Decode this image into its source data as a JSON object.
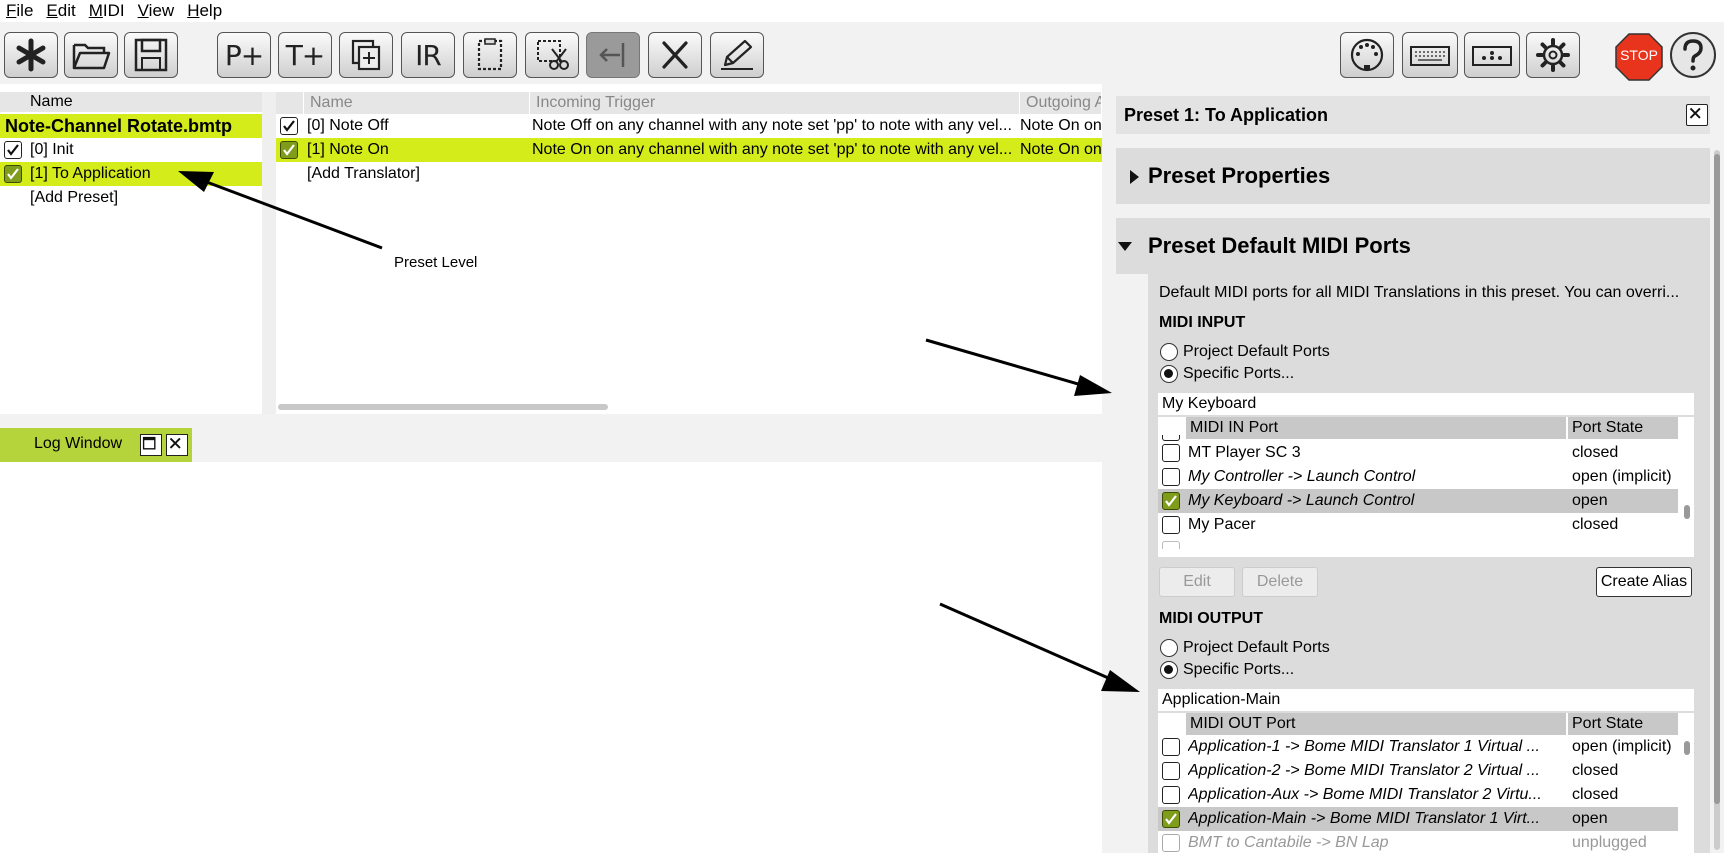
{
  "menu": {
    "items": [
      {
        "key": "F",
        "rest": "ile"
      },
      {
        "key": "E",
        "rest": "dit"
      },
      {
        "key": "M",
        "rest": "IDI"
      },
      {
        "key": "V",
        "rest": "iew"
      },
      {
        "key": "H",
        "rest": "elp"
      }
    ]
  },
  "toolbar": {
    "p_plus": "P+",
    "t_plus": "T+",
    "ir": "IR",
    "stop": "STOP"
  },
  "presets": {
    "header": "Name",
    "project": "Note-Channel Rotate.bmtp",
    "items": [
      {
        "label": "[0] Init",
        "checked": true
      },
      {
        "label": "[1] To Application",
        "checked": true
      }
    ],
    "add": "[Add Preset]"
  },
  "translators": {
    "headers": [
      "Name",
      "Incoming Trigger",
      "Outgoing A"
    ],
    "rows": [
      {
        "name": "[0] Note Off",
        "incoming": "Note Off on any channel with any note set 'pp' to note with any vel...",
        "outgoing": "Note On on"
      },
      {
        "name": "[1] Note On",
        "incoming": "Note On on any channel with any note set 'pp' to note with any vel...",
        "outgoing": "Note On on"
      }
    ],
    "add": "[Add Translator]"
  },
  "annotation": {
    "preset_level": "Preset Level"
  },
  "log": {
    "title": "Log Window"
  },
  "properties": {
    "title": "Preset 1: To Application",
    "section1": "Preset Properties",
    "section2": "Preset Default MIDI Ports",
    "description": "Default MIDI ports for all MIDI Translations in this preset. You can overri...",
    "midi_input": {
      "label": "MIDI INPUT",
      "radio1": "Project Default Ports",
      "radio2": "Specific Ports...",
      "field": "My Keyboard",
      "col_port": "MIDI IN Port",
      "col_state": "Port State",
      "rows": [
        {
          "name": "MT Player SC 3",
          "state": "closed",
          "italic": false,
          "checked": false
        },
        {
          "name": "My Controller -> Launch Control",
          "state": "open (implicit)",
          "italic": true,
          "checked": false
        },
        {
          "name": "My Keyboard -> Launch Control",
          "state": "open",
          "italic": true,
          "checked": true
        },
        {
          "name": "My Pacer",
          "state": "closed",
          "italic": false,
          "checked": false
        }
      ]
    },
    "buttons": {
      "edit": "Edit",
      "delete": "Delete",
      "create_alias": "Create Alias"
    },
    "midi_output": {
      "label": "MIDI OUTPUT",
      "radio1": "Project Default Ports",
      "radio2": "Specific Ports...",
      "field": "Application-Main",
      "col_port": "MIDI OUT Port",
      "col_state": "Port State",
      "rows": [
        {
          "name": "Application-1 -> Bome MIDI Translator 1 Virtual ...",
          "state": "open (implicit)",
          "checked": false
        },
        {
          "name": "Application-2 -> Bome MIDI Translator 2 Virtual ...",
          "state": "closed",
          "checked": false
        },
        {
          "name": "Application-Aux -> Bome MIDI Translator 2 Virtu...",
          "state": "closed",
          "checked": false
        },
        {
          "name": "Application-Main -> Bome MIDI Translator 1 Virt...",
          "state": "open",
          "checked": true
        },
        {
          "name": "BMT to Cantabile -> BN Lap",
          "state": "unplugged",
          "checked": false
        }
      ]
    }
  },
  "colors": {
    "selection": "#d4ec1a",
    "checked": "#7f9c1a",
    "log_tab": "#b5d33b",
    "stop": "#e8341c"
  }
}
